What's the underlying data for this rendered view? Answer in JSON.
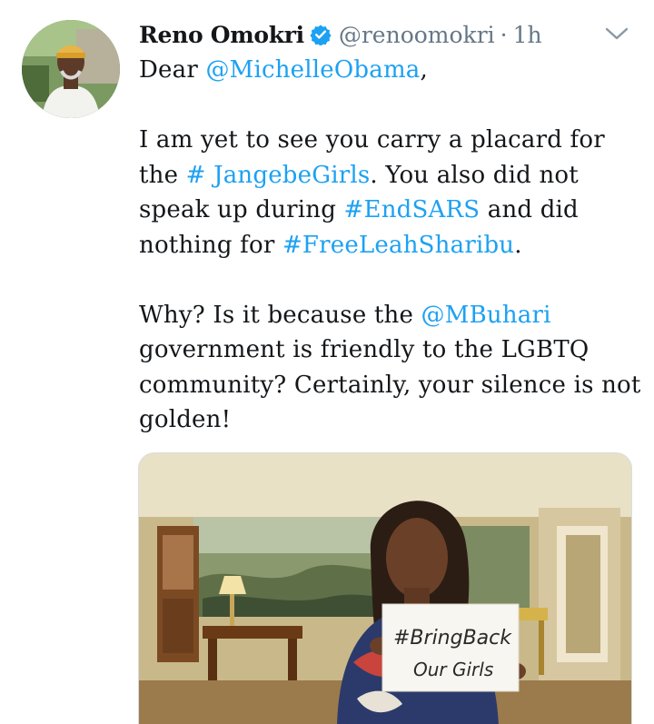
{
  "tweet": {
    "author": {
      "display_name": "Reno Omokri",
      "handle": "@renoomokri",
      "verified": true
    },
    "separator": "·",
    "timestamp": "1h",
    "text": {
      "line1_prefix": "Dear ",
      "mention_michelle": "@MichelleObama",
      "line1_suffix": ",",
      "p2_part1": "I am yet to see you carry a placard for the ",
      "hashtag_jangebe": "# JangebeGirls",
      "p2_part2": ". You also did not speak up during ",
      "hashtag_endsars": "#EndSARS",
      "p2_part3": " and did nothing for ",
      "hashtag_freeleah": "#FreeLeahSharibu",
      "p2_part4": ".",
      "p3_part1": "Why? Is it because the ",
      "mention_buhari": "@MBuhari",
      "p3_part2": " government is friendly to the LGBTQ community? Certainly, your silence is not golden!"
    },
    "media": {
      "sign_line1": "#BringBack",
      "sign_line2": "Our Girls"
    }
  },
  "colors": {
    "link": "#1da1f2",
    "muted": "#657786",
    "text": "#14171a"
  },
  "icons": {
    "verified": "verified-badge-icon",
    "menu": "chevron-down-icon"
  }
}
